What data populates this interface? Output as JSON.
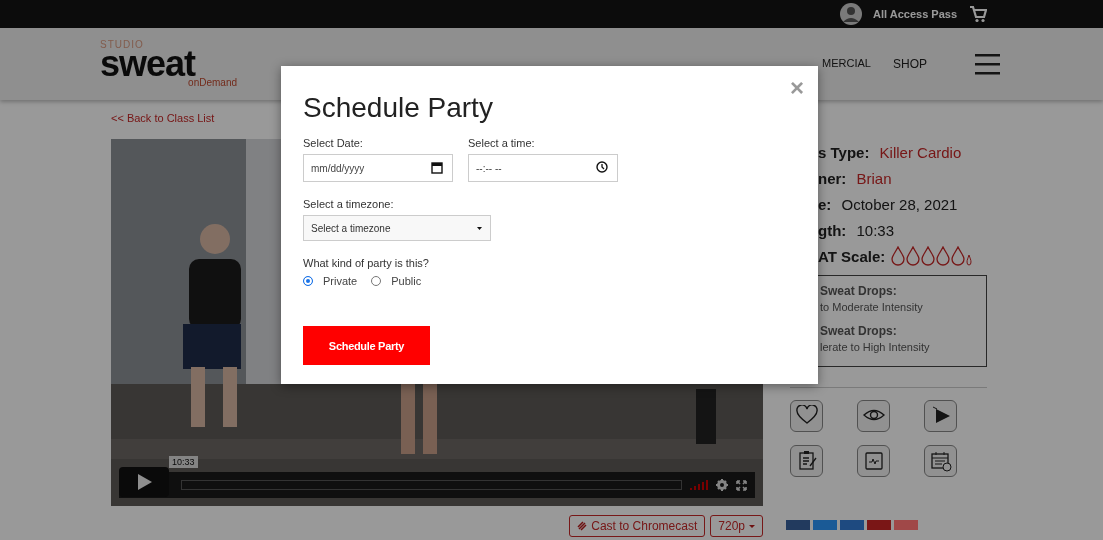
{
  "top_bar": {
    "account": "All Access Pass"
  },
  "header": {
    "logo": {
      "top": "STUDIO",
      "main": "sweat",
      "sub": "onDemand"
    },
    "nav": [
      {
        "label": "MERCIAL"
      },
      {
        "label": "SHOP"
      }
    ]
  },
  "back_link": "<< Back to Class List",
  "player": {
    "time_tooltip": "10:33",
    "progress": {
      "level": 0
    }
  },
  "video_actions": [
    {
      "label": "Cast to Chromecast",
      "kind": "cast"
    },
    {
      "label": "720p",
      "kind": "quality"
    }
  ],
  "class_info": [
    {
      "label": "s Type:",
      "value": "Killer Cardio",
      "kind": "link"
    },
    {
      "label": "ner:",
      "value": "Brian",
      "kind": "link"
    },
    {
      "label": "e:",
      "value": "October 28, 2021",
      "kind": "plain"
    },
    {
      "label": "gth:",
      "value": "10:33",
      "kind": "plain"
    },
    {
      "label": "AT Scale:",
      "kind": "drops",
      "stars": 0
    }
  ],
  "legend": [
    {
      "title": "Sweat Drops:",
      "text": "to Moderate Intensity"
    },
    {
      "title": "Sweat Drops:",
      "text": "lerate to High Intensity"
    }
  ],
  "share_buttons": [
    {
      "color": "#223a5e"
    },
    {
      "color": "#1a5a96"
    },
    {
      "color": "#1e4a80"
    },
    {
      "color": "#7a1616"
    },
    {
      "color": "#a04848"
    }
  ],
  "modal": {
    "title": "Schedule Party",
    "close": "×",
    "date": {
      "label": "Select Date:",
      "placeholder": "mm/dd/yyyy"
    },
    "time": {
      "label": "Select a time:",
      "placeholder": "--:-- --"
    },
    "timezone": {
      "label": "Select a timezone:",
      "value": "Select a timezone"
    },
    "party_type": {
      "question": "What kind of party is this?",
      "options": [
        {
          "label": "Private",
          "selected": true
        },
        {
          "label": "Public",
          "selected": false
        }
      ]
    },
    "submit": "Schedule Party"
  }
}
